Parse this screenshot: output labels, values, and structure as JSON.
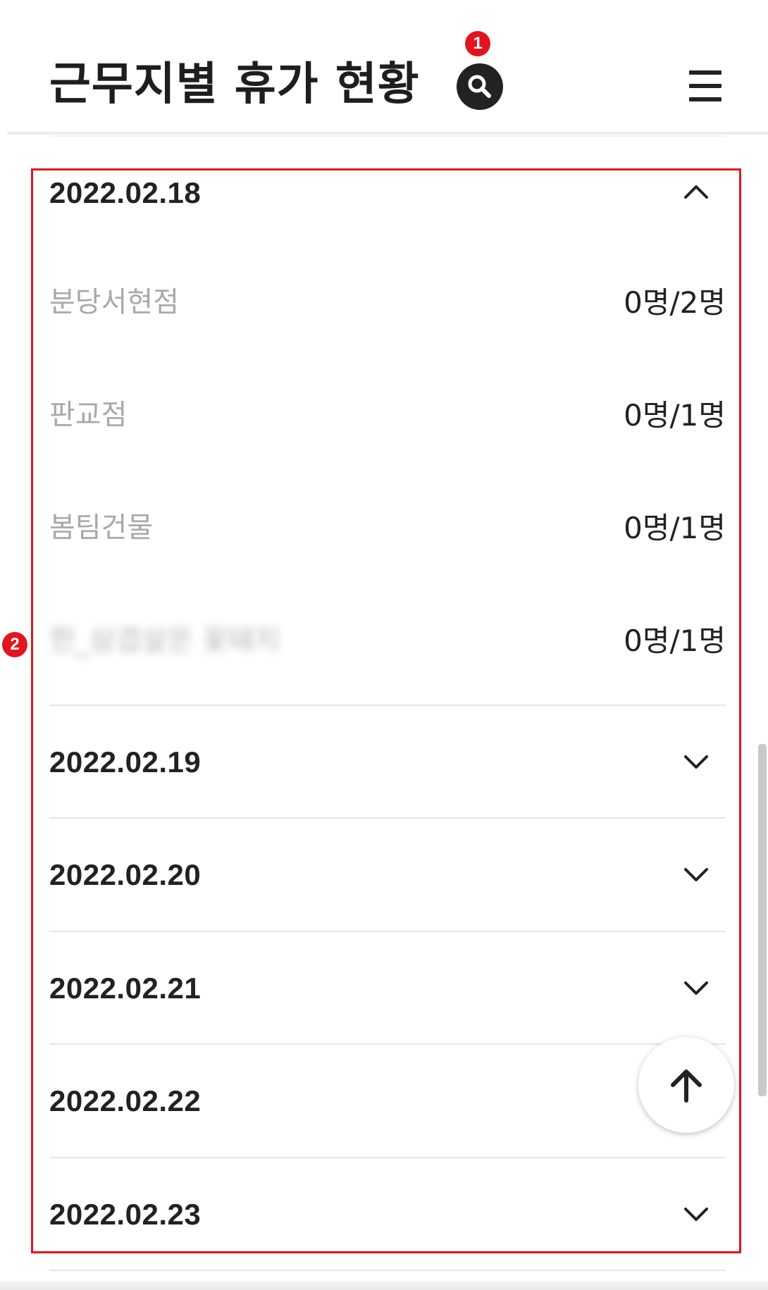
{
  "header": {
    "title": "근무지별 휴가 현황",
    "search_icon": "search-icon",
    "menu_icon": "hamburger-menu-icon",
    "badge_1": "1"
  },
  "annotation": {
    "badge_2": "2"
  },
  "expanded_group": {
    "date": "2022.02.18",
    "icon": "chevron-up-icon",
    "sites": [
      {
        "name": "분당서현점",
        "count": "0명/2명"
      },
      {
        "name": "판교점",
        "count": "0명/1명"
      },
      {
        "name": "봄팀건물",
        "count": "0명/1명"
      },
      {
        "name": "한_삼겹살은 꽃돼지",
        "count": "0명/1명"
      }
    ]
  },
  "collapsed_groups": [
    {
      "date": "2022.02.19",
      "icon": "chevron-down-icon"
    },
    {
      "date": "2022.02.20",
      "icon": "chevron-down-icon"
    },
    {
      "date": "2022.02.21",
      "icon": "chevron-down-icon"
    },
    {
      "date": "2022.02.22",
      "icon": "chevron-down-icon"
    },
    {
      "date": "2022.02.23",
      "icon": "chevron-down-icon"
    }
  ],
  "fab": {
    "icon": "arrow-up-icon"
  },
  "colors": {
    "accent": "#e3141e",
    "text": "#222222",
    "muted": "#a9a9a9"
  }
}
